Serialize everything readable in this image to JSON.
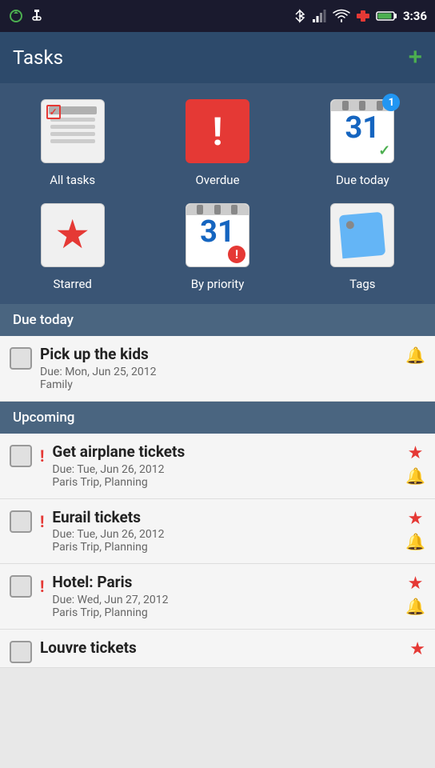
{
  "statusBar": {
    "time": "3:36",
    "icons": [
      "sync-icon",
      "usb-icon",
      "bluetooth-icon",
      "signal-icon",
      "wifi-icon",
      "medical-icon",
      "battery-icon"
    ]
  },
  "header": {
    "title": "Tasks",
    "addButton": "+"
  },
  "categories": [
    {
      "id": "all-tasks",
      "label": "All tasks",
      "type": "alltasks"
    },
    {
      "id": "overdue",
      "label": "Overdue",
      "type": "overdue"
    },
    {
      "id": "due-today",
      "label": "Due today",
      "type": "duetoday",
      "badge": "1"
    },
    {
      "id": "starred",
      "label": "Starred",
      "type": "starred"
    },
    {
      "id": "by-priority",
      "label": "By priority",
      "type": "bypriority"
    },
    {
      "id": "tags",
      "label": "Tags",
      "type": "tags"
    }
  ],
  "sections": [
    {
      "id": "due-today-section",
      "label": "Due today",
      "tasks": [
        {
          "id": "task-1",
          "title": "Pick up the kids",
          "due": "Due: Mon, Jun 25, 2012",
          "tags": "Family",
          "starred": false,
          "hasBell": true,
          "priority": false
        }
      ]
    },
    {
      "id": "upcoming-section",
      "label": "Upcoming",
      "tasks": [
        {
          "id": "task-2",
          "title": "Get airplane tickets",
          "due": "Due: Tue, Jun 26, 2012",
          "tags": "Paris Trip, Planning",
          "starred": true,
          "hasBell": true,
          "priority": true
        },
        {
          "id": "task-3",
          "title": "Eurail tickets",
          "due": "Due: Tue, Jun 26, 2012",
          "tags": "Paris Trip, Planning",
          "starred": true,
          "hasBell": true,
          "priority": true
        },
        {
          "id": "task-4",
          "title": "Hotel: Paris",
          "due": "Due: Wed, Jun 27, 2012",
          "tags": "Paris Trip, Planning",
          "starred": true,
          "hasBell": true,
          "priority": true
        },
        {
          "id": "task-5",
          "title": "Louvre tickets",
          "due": "",
          "tags": "",
          "starred": true,
          "hasBell": false,
          "priority": false
        }
      ]
    }
  ]
}
